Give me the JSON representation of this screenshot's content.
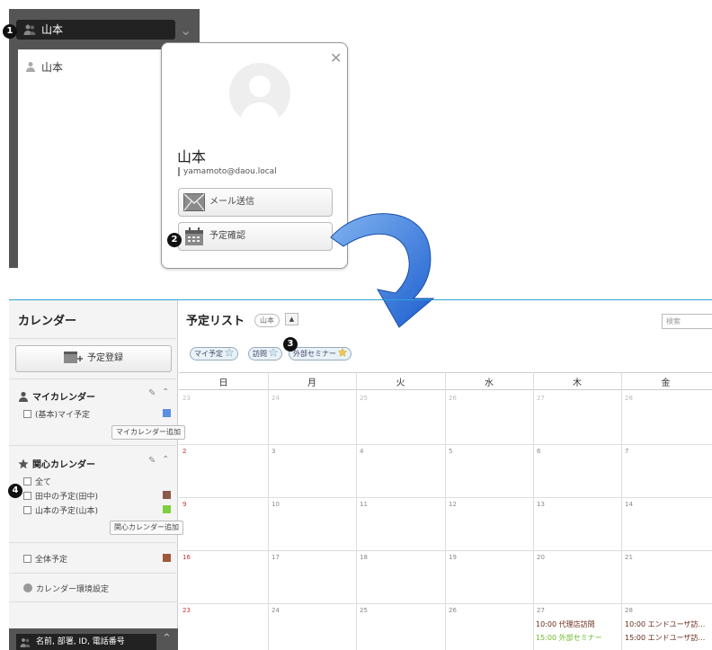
{
  "colors": {
    "accent": "#2aa4d8",
    "arrow_blue": "#2a6ed8",
    "basic_calendar": "#5b8fe0",
    "tanaka_calendar": "#8a5a4a",
    "yamamoto_calendar": "#7fcf3f",
    "all_calendar": "#a0583c",
    "sunday_red": "#cc3333",
    "event_dark": "#6a2a1a",
    "event_green": "#6ab82a"
  },
  "top": {
    "field_value": "山本",
    "list_item": "山本",
    "popup": {
      "name": "山本",
      "email": "yamamoto@daou.local",
      "mail_button": "メール送信",
      "schedule_button": "予定確認"
    }
  },
  "badges": [
    "1",
    "2",
    "3",
    "4"
  ],
  "calendar": {
    "sidebar": {
      "title": "カレンダー",
      "register_button": "予定登録",
      "my_calendar": {
        "title": "マイカレンダー",
        "items": [
          {
            "label": "(基本)マイ予定"
          }
        ],
        "add_button": "マイカレンダー追加"
      },
      "interest_calendar": {
        "title": "関心カレンダー",
        "all_label": "全て",
        "items": [
          {
            "label": "田中の予定(田中)"
          },
          {
            "label": "山本の予定(山本)"
          }
        ],
        "add_button": "関心カレンダー追加"
      },
      "all_schedule": "全体予定",
      "settings": "カレンダー環境設定",
      "bottom_search": "名前, 部署, ID, 電話番号"
    },
    "main": {
      "title": "予定リスト",
      "owner_tag": "山本",
      "search_placeholder": "検索",
      "filters": [
        "マイ予定",
        "訪問",
        "外部セミナー"
      ],
      "weekdays": [
        "日",
        "月",
        "火",
        "水",
        "木",
        "金"
      ],
      "weeks": [
        [
          "23",
          "24",
          "25",
          "26",
          "27",
          "28"
        ],
        [
          "2",
          "3",
          "4",
          "5",
          "6",
          "7"
        ],
        [
          "9",
          "10",
          "11",
          "12",
          "13",
          "14"
        ],
        [
          "16",
          "17",
          "18",
          "19",
          "20",
          "21"
        ],
        [
          "23",
          "24",
          "25",
          "26",
          "27",
          "28"
        ]
      ],
      "events": {
        "thu": [
          {
            "text": "10:00 代理店訪問"
          },
          {
            "text": "15:00 外部セミナー"
          }
        ],
        "fri": [
          {
            "text": "10:00 エンドユーザ訪…"
          },
          {
            "text": "15:00 エンドユーザ訪…"
          }
        ]
      }
    }
  }
}
